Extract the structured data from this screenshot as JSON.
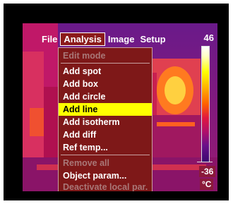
{
  "menubar": {
    "items": [
      {
        "label": "File",
        "active": false
      },
      {
        "label": "Analysis",
        "active": true
      },
      {
        "label": "Image",
        "active": false
      },
      {
        "label": "Setup",
        "active": false
      }
    ]
  },
  "analysis_menu": {
    "items": [
      {
        "label": "Edit mode",
        "enabled": false,
        "selected": false
      },
      {
        "label": "Add spot",
        "enabled": true,
        "selected": false
      },
      {
        "label": "Add box",
        "enabled": true,
        "selected": false
      },
      {
        "label": "Add circle",
        "enabled": true,
        "selected": false
      },
      {
        "label": "Add line",
        "enabled": true,
        "selected": true
      },
      {
        "label": "Add isotherm",
        "enabled": true,
        "selected": false
      },
      {
        "label": "Add diff",
        "enabled": true,
        "selected": false
      },
      {
        "label": "Ref temp...",
        "enabled": true,
        "selected": false
      },
      {
        "label": "Remove all",
        "enabled": false,
        "selected": false
      },
      {
        "label": "Object param...",
        "enabled": true,
        "selected": false
      },
      {
        "label": "Deactivate local par.",
        "enabled": false,
        "selected": false
      }
    ]
  },
  "scale": {
    "max": "46",
    "min": "-36",
    "unit": "°C"
  },
  "colors": {
    "menu_bg": "#7e1818",
    "highlight": "#ffff00",
    "disabled_text": "#a97777"
  }
}
